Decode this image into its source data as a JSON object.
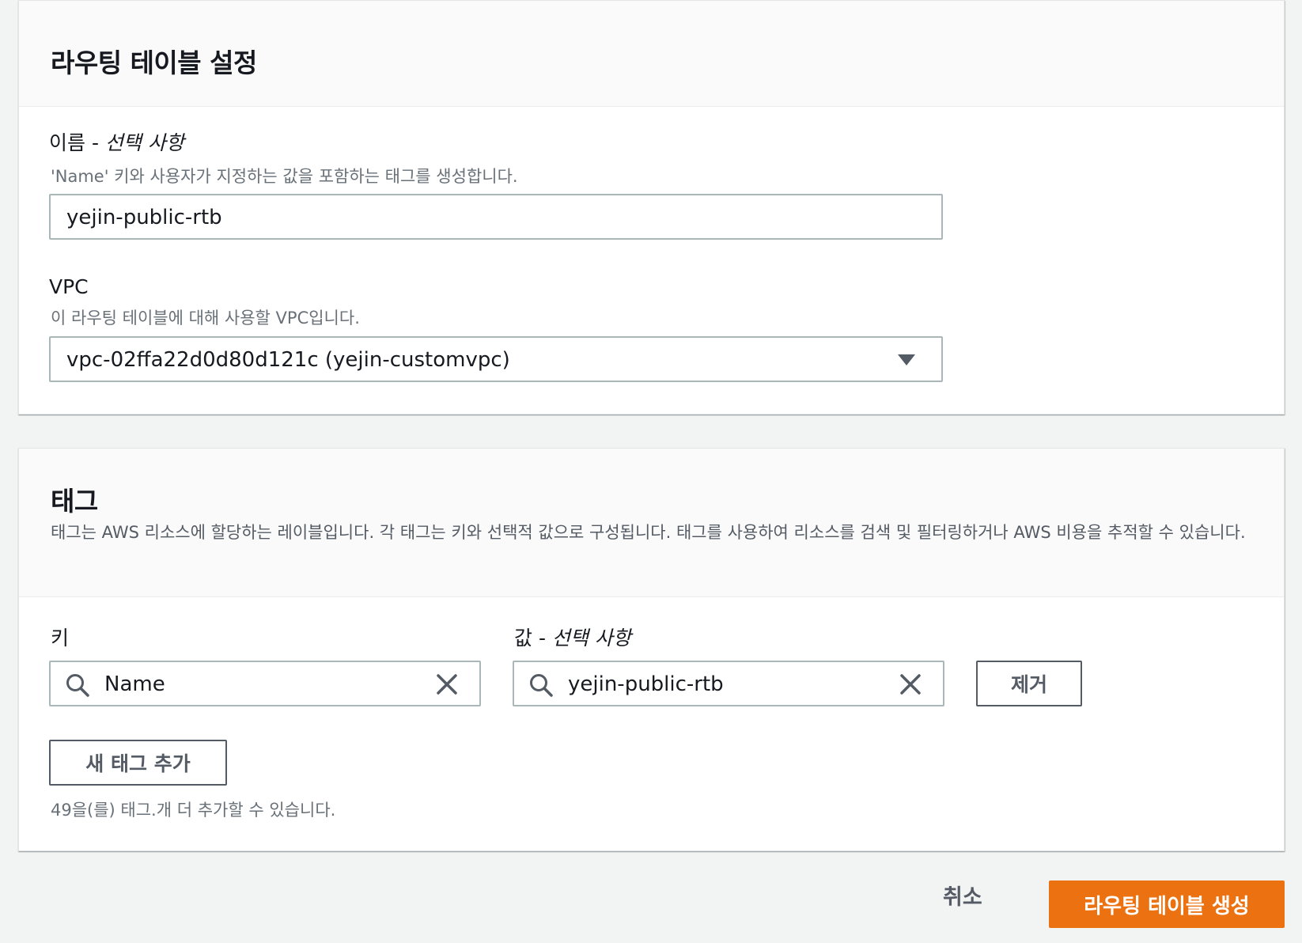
{
  "route_table_settings": {
    "title": "라우팅 테이블 설정",
    "name_label": "이름 - ",
    "name_optional": "선택 사항",
    "name_hint": "'Name' 키와 사용자가 지정하는 값을 포함하는 태그를 생성합니다.",
    "name_value": "yejin-public-rtb",
    "vpc_label": "VPC",
    "vpc_hint": "이 라우팅 테이블에 대해 사용할 VPC입니다.",
    "vpc_value": "vpc-02ffa22d0d80d121c (yejin-customvpc)"
  },
  "tags": {
    "title": "태그",
    "description": "태그는 AWS 리소스에 할당하는 레이블입니다. 각 태그는 키와 선택적 값으로 구성됩니다. 태그를 사용하여 리소스를 검색 및 필터링하거나 AWS 비용을 추적할 수 있습니다.",
    "key_label": "키",
    "value_label": "값 - ",
    "value_optional": "선택 사항",
    "key_value": "Name",
    "value_value": "yejin-public-rtb",
    "remove_label": "제거",
    "add_label": "새 태그 추가",
    "limit_text": "49을(를) 태그.개 더 추가할 수 있습니다."
  },
  "footer": {
    "cancel_label": "취소",
    "create_label": "라우팅 테이블 생성"
  },
  "colors": {
    "primary": "#ec7211",
    "background": "#f2f3f3"
  },
  "icons": [
    "search-icon",
    "clear-icon",
    "dropdown-caret-icon"
  ]
}
